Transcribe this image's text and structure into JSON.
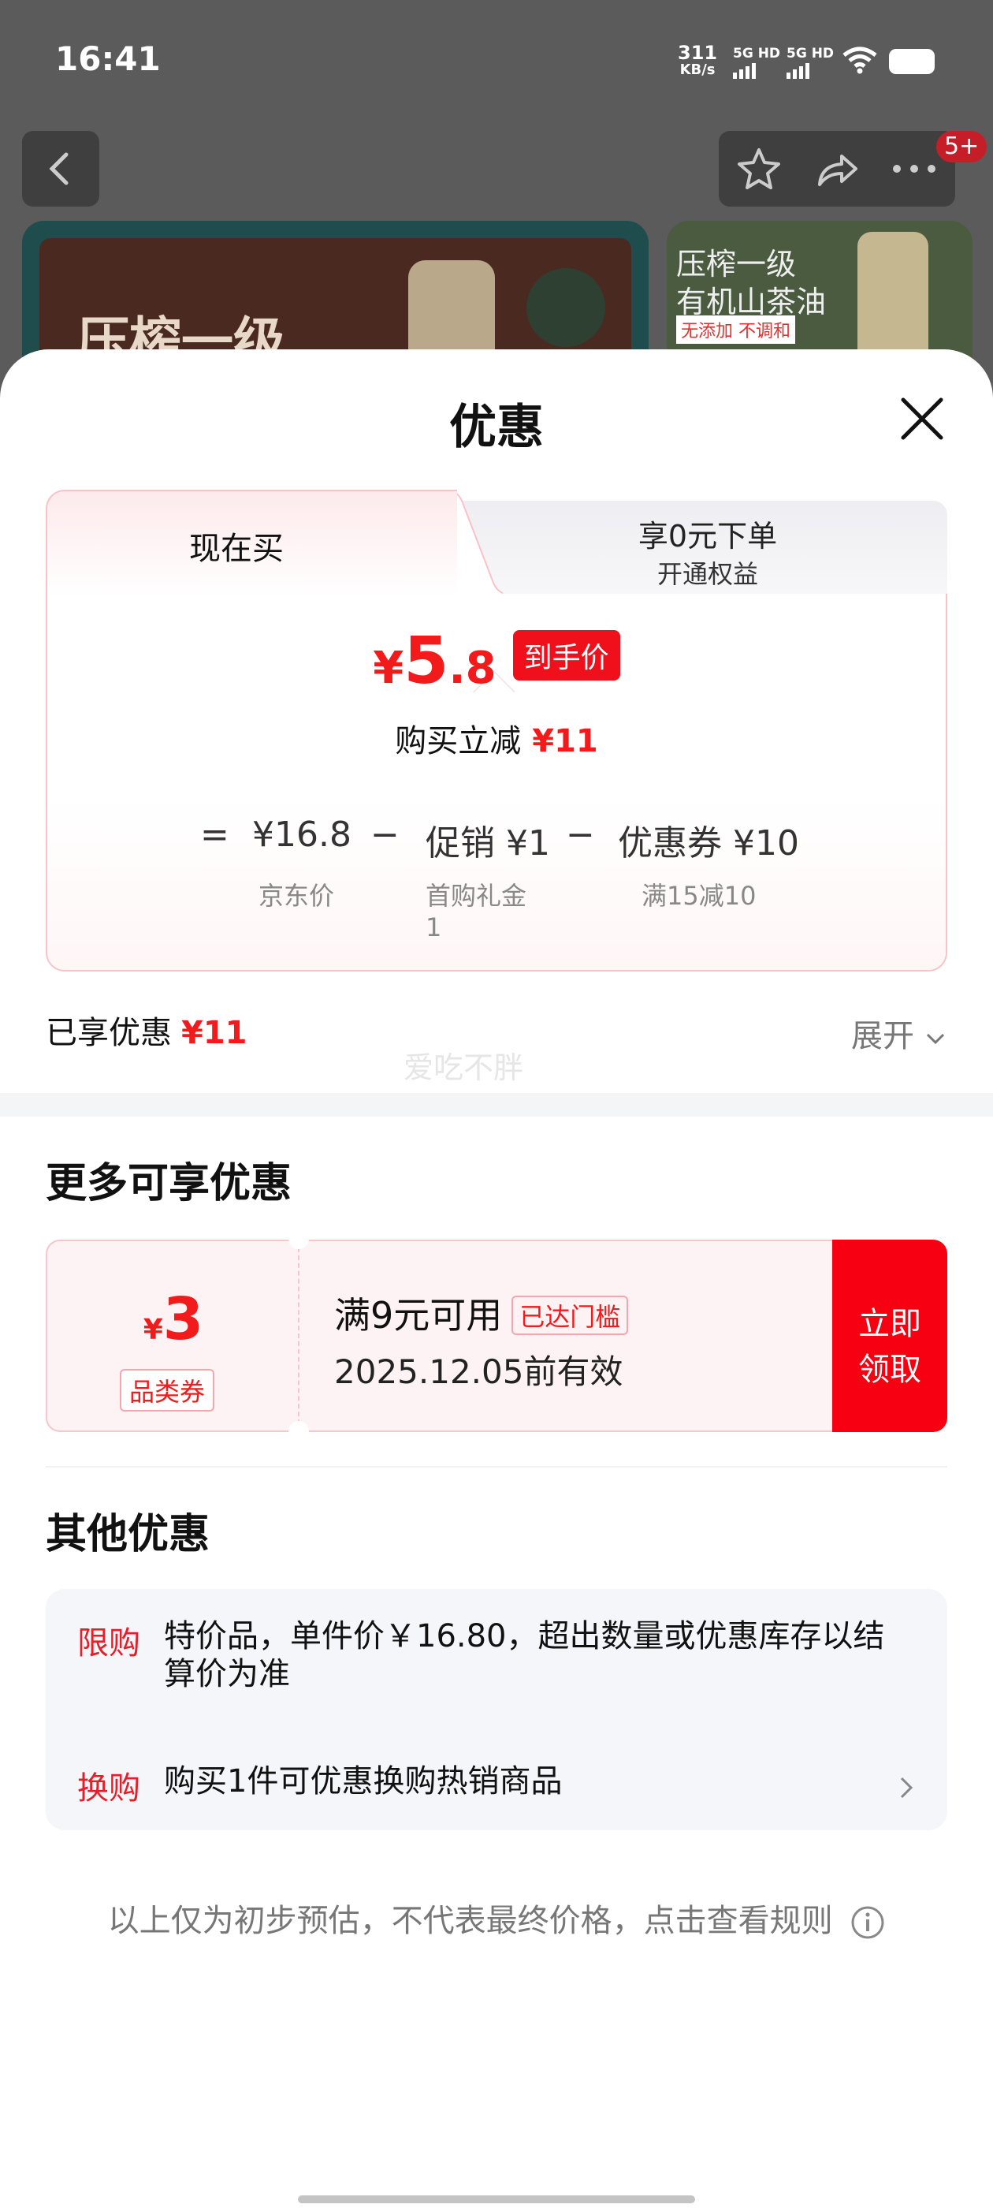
{
  "status_bar": {
    "time": "16:41",
    "net_speed": "311",
    "net_unit": "KB/s",
    "sim1": "5G HD",
    "sim2": "5G HD"
  },
  "background_page": {
    "cart_badge": "5+",
    "banner_main_text": "压榨一级",
    "banner_side_line1": "压榨一级",
    "banner_side_line2": "有机山茶油",
    "banner_side_line3": "无添加 不调和"
  },
  "sheet": {
    "title": "优惠",
    "tabs": [
      {
        "label": "现在买"
      },
      {
        "label": "享0元下单",
        "sublabel": "开通权益"
      }
    ],
    "price": {
      "currency": "¥",
      "integer": "5",
      "decimal": ".8",
      "tag": "到手价"
    },
    "reduce": {
      "label": "购买立减",
      "amount": "¥11"
    },
    "formula": {
      "eq": "=",
      "jd_price": "¥16.8",
      "minus1": "−",
      "promo": "促销 ¥1",
      "minus2": "−",
      "coupon": "优惠券 ¥10",
      "jd_label": "京东价",
      "promo_label_1": "首购礼金",
      "promo_label_2": "1",
      "coupon_label": "满15减10"
    },
    "enjoyed": {
      "label": "已享优惠",
      "amount": "¥11",
      "expand": "展开"
    },
    "watermark": "爱吃不胖"
  },
  "more": {
    "title": "更多可享优惠",
    "coupon": {
      "currency": "¥",
      "value": "3",
      "type": "品类券",
      "condition": "满9元可用",
      "reached": "已达门槛",
      "validity": "2025.12.05前有效",
      "button_line1": "立即",
      "button_line2": "领取"
    }
  },
  "other": {
    "title": "其他优惠",
    "items": [
      {
        "label": "限购",
        "text": "特价品，单件价￥16.80，超出数量或优惠库存以结算价为准"
      },
      {
        "label": "换购",
        "text": "购买1件可优惠换购热销商品"
      }
    ]
  },
  "footnote": "以上仅为初步预估，不代表最终价格，点击查看规则",
  "colors": {
    "accent": "#f21a1a",
    "button": "#f70011",
    "pink_border": "#f7c3c8"
  }
}
